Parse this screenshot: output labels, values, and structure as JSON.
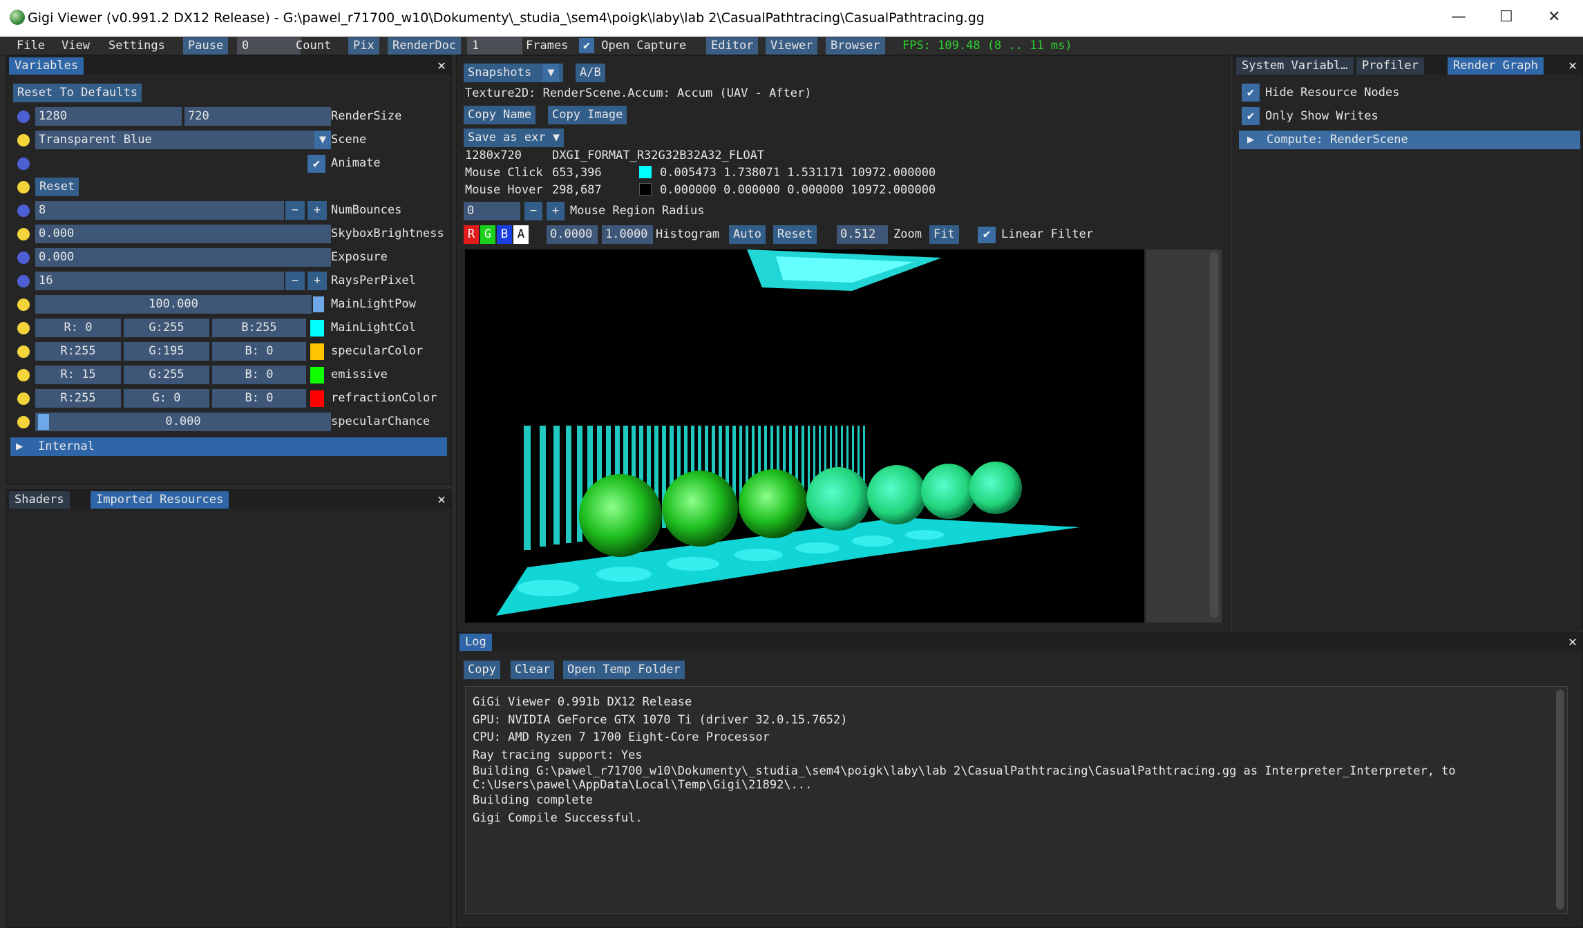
{
  "window": {
    "title": "Gigi Viewer (v0.991.2 DX12 Release) - G:\\pawel_r71700_w10\\Dokumenty\\_studia_\\sem4\\poigk\\laby\\lab 2\\CasualPathtracing\\CasualPathtracing.gg",
    "minimize": "—",
    "maximize": "☐",
    "close": "✕"
  },
  "menubar": {
    "file": "File",
    "view": "View",
    "settings": "Settings",
    "pause": "Pause",
    "pause_value": "0",
    "count": "Count",
    "pix": "Pix",
    "renderdoc": "RenderDoc",
    "frames_value": "1",
    "frames": "Frames",
    "open_capture": "Open Capture",
    "editor": "Editor",
    "viewer": "Viewer",
    "browser": "Browser",
    "fps": "FPS: 109.48 (8 .. 11 ms)"
  },
  "variables_panel": {
    "tab": "Variables",
    "reset_defaults": "Reset To Defaults",
    "render_size": {
      "w": "1280",
      "h": "720",
      "label": "RenderSize"
    },
    "scene": {
      "value": "Transparent Blue",
      "label": "Scene"
    },
    "animate": {
      "label": "Animate"
    },
    "reset": "Reset",
    "num_bounces": {
      "value": "8",
      "label": "NumBounces"
    },
    "skybox": {
      "value": "0.000",
      "label": "SkyboxBrightness"
    },
    "exposure": {
      "value": "0.000",
      "label": "Exposure"
    },
    "rays": {
      "value": "16",
      "label": "RaysPerPixel"
    },
    "main_light_pow": {
      "value": "100.000",
      "label": "MainLightPow"
    },
    "main_light_col": {
      "r": "R:  0",
      "g": "G:255",
      "b": "B:255",
      "label": "MainLightCol",
      "color": "#00ffff"
    },
    "specular_color": {
      "r": "R:255",
      "g": "G:195",
      "b": "B:  0",
      "label": "specularColor",
      "color": "#ffc300"
    },
    "emissive": {
      "r": "R: 15",
      "g": "G:255",
      "b": "B:  0",
      "label": "emissive",
      "color": "#0fff00"
    },
    "refraction_color": {
      "r": "R:255",
      "g": "G:  0",
      "b": "B:  0",
      "label": "refractionColor",
      "color": "#ff0000"
    },
    "specular_chance": {
      "value": "0.000",
      "label": "specularChance"
    },
    "internal": "Internal",
    "minus": "−",
    "plus": "+"
  },
  "bottom_left_panel": {
    "tab_shaders": "Shaders",
    "tab_imported": "Imported Resources"
  },
  "viewer": {
    "snapshots": "Snapshots",
    "ab": "A/B",
    "texture_title": "Texture2D: RenderScene.Accum: Accum (UAV - After)",
    "copy_name": "Copy Name",
    "copy_image": "Copy Image",
    "save_as": "Save as exr",
    "dims": "1280x720",
    "format": "DXGI_FORMAT_R32G32B32A32_FLOAT",
    "mouse_click_label": "Mouse Click",
    "mouse_click_pos": "653,396",
    "mouse_click_val": "0.005473 1.738071 1.531171 10972.000000",
    "mouse_click_color": "#00ffff",
    "mouse_hover_label": "Mouse Hover",
    "mouse_hover_pos": "298,687",
    "mouse_hover_val": "0.000000 0.000000 0.000000 10972.000000",
    "mouse_hover_color": "#000000",
    "radius_value": "0",
    "radius_label": "Mouse Region Radius",
    "ch_r": "R",
    "ch_g": "G",
    "ch_b": "B",
    "ch_a": "A",
    "hist_min": "0.0000",
    "hist_max": "1.0000",
    "histogram": "Histogram",
    "auto": "Auto",
    "reset": "Reset",
    "zoom_value": "0.512",
    "zoom": "Zoom",
    "fit": "Fit",
    "linear_filter": "Linear Filter"
  },
  "right_panel": {
    "tab_system": "System Variabl…",
    "tab_profiler": "Profiler",
    "tab_render_graph": "Render Graph",
    "hide_resource_nodes": "Hide Resource Nodes",
    "only_show_writes": "Only Show Writes",
    "compute_node": "Compute: RenderScene"
  },
  "log": {
    "tab": "Log",
    "copy": "Copy",
    "clear": "Clear",
    "open_temp": "Open Temp Folder",
    "lines": [
      "GiGi Viewer 0.991b DX12 Release",
      "GPU: NVIDIA GeForce GTX 1070 Ti (driver 32.0.15.7652)",
      "CPU: AMD Ryzen 7 1700 Eight-Core Processor",
      "Ray tracing support: Yes",
      "Building G:\\pawel_r71700_w10\\Dokumenty\\_studia_\\sem4\\poigk\\laby\\lab 2\\CasualPathtracing\\CasualPathtracing.gg as Interpreter_Interpreter, to",
      "C:\\Users\\pawel\\AppData\\Local\\Temp\\Gigi\\21892\\...",
      "Building complete",
      "Gigi Compile Successful."
    ]
  }
}
